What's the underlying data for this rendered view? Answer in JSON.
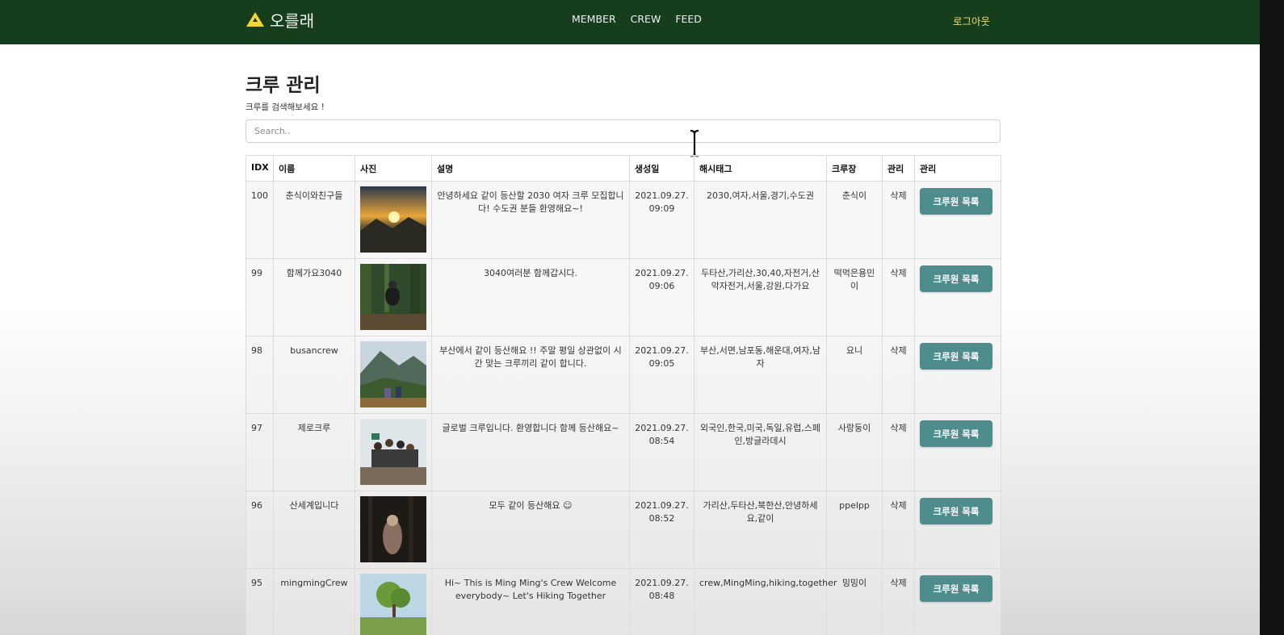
{
  "navbar": {
    "brand": "오를래",
    "links": [
      "MEMBER",
      "CREW",
      "FEED"
    ],
    "logout": "로그아웃",
    "colors": {
      "background": "#163d1c",
      "logout": "#e8dc7a",
      "logo": "#f2d531"
    }
  },
  "page": {
    "title": "크루 관리",
    "subtitle": "크루를 검색해보세요 !",
    "search_placeholder": "Search.."
  },
  "table": {
    "headers": [
      "IDX",
      "이름",
      "사진",
      "설명",
      "생성일",
      "해시태그",
      "크루장",
      "관리",
      "관리"
    ],
    "rows": [
      {
        "idx": "100",
        "name": "춘식이와친구들",
        "photo": "sunset-mountain-photo",
        "description": "안녕하세요 같이 등산할 2030 여자 크루 모집합니다! 수도권 분들 환영해요~!",
        "created": "2021.09.27. 09:09",
        "hashtags": "2030,여자,서울,경기,수도권",
        "leader": "춘식이",
        "delete": "삭제",
        "button": "크루원 목록"
      },
      {
        "idx": "99",
        "name": "함께가요3040",
        "photo": "forest-biker-photo",
        "description": "3040여러분 함께갑시다.",
        "created": "2021.09.27. 09:06",
        "hashtags": "두타산,가리산,30,40,자전거,산악자전거,서울,강원,다가요",
        "leader": "떡먹은용민이",
        "delete": "삭제",
        "button": "크루원 목록"
      },
      {
        "idx": "98",
        "name": "busancrew",
        "photo": "mountain-hikers-photo",
        "description": "부산에서 같이 등산해요 !! 주말 평일 상관없이 시간 맞는 크루끼리 같이 합니다.",
        "created": "2021.09.27. 09:05",
        "hashtags": "부산,서면,남포동,해운대,여자,남자",
        "leader": "요니",
        "delete": "삭제",
        "button": "크루원 목록"
      },
      {
        "idx": "97",
        "name": "제로크루",
        "photo": "group-summit-photo",
        "description": "글로벌 크루입니다. 환영합니다 함께 등산해요~",
        "created": "2021.09.27. 08:54",
        "hashtags": "외국인,한국,미국,독일,유럽,스페인,방글라데시",
        "leader": "사랑둥이",
        "delete": "삭제",
        "button": "크루원 목록"
      },
      {
        "idx": "96",
        "name": "산세계입니다",
        "photo": "dark-forest-photo",
        "description": "모두 같이 등산해요 ☺",
        "created": "2021.09.27. 08:52",
        "hashtags": "가리산,두타산,북한산,안녕하세요,같이",
        "leader": "ppelpp",
        "delete": "삭제",
        "button": "크루원 목록"
      },
      {
        "idx": "95",
        "name": "mingmingCrew",
        "photo": "green-tree-photo",
        "description": "Hi~ This is Ming Ming's Crew Welcome everybody~ Let's Hiking Together",
        "created": "2021.09.27. 08:48",
        "hashtags": "crew,MingMing,hiking,together",
        "leader": "밍밍이",
        "delete": "삭제",
        "button": "크루원 목록"
      }
    ]
  },
  "colors": {
    "member_button": "#4f8c8c"
  }
}
